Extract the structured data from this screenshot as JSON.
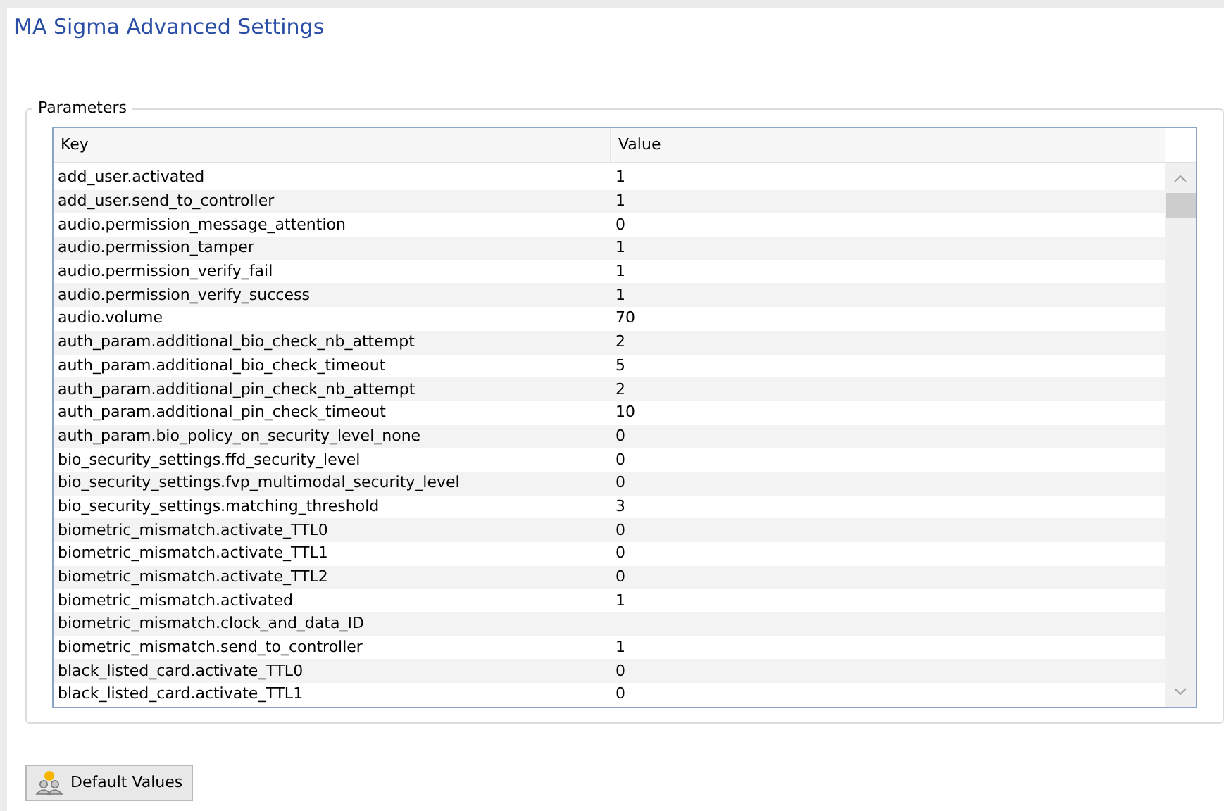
{
  "title": "MA Sigma Advanced Settings",
  "group": {
    "legend": "Parameters"
  },
  "table": {
    "columns": [
      "Key",
      "Value"
    ],
    "rows": [
      {
        "key": "add_user.activated",
        "value": "1"
      },
      {
        "key": "add_user.send_to_controller",
        "value": "1"
      },
      {
        "key": "audio.permission_message_attention",
        "value": "0"
      },
      {
        "key": "audio.permission_tamper",
        "value": "1"
      },
      {
        "key": "audio.permission_verify_fail",
        "value": "1"
      },
      {
        "key": "audio.permission_verify_success",
        "value": "1"
      },
      {
        "key": "audio.volume",
        "value": "70"
      },
      {
        "key": "auth_param.additional_bio_check_nb_attempt",
        "value": "2"
      },
      {
        "key": "auth_param.additional_bio_check_timeout",
        "value": "5"
      },
      {
        "key": "auth_param.additional_pin_check_nb_attempt",
        "value": "2"
      },
      {
        "key": "auth_param.additional_pin_check_timeout",
        "value": "10"
      },
      {
        "key": "auth_param.bio_policy_on_security_level_none",
        "value": "0"
      },
      {
        "key": "bio_security_settings.ffd_security_level",
        "value": "0"
      },
      {
        "key": "bio_security_settings.fvp_multimodal_security_level",
        "value": "0"
      },
      {
        "key": "bio_security_settings.matching_threshold",
        "value": "3"
      },
      {
        "key": "biometric_mismatch.activate_TTL0",
        "value": "0"
      },
      {
        "key": "biometric_mismatch.activate_TTL1",
        "value": "0"
      },
      {
        "key": "biometric_mismatch.activate_TTL2",
        "value": "0"
      },
      {
        "key": "biometric_mismatch.activated",
        "value": "1"
      },
      {
        "key": "biometric_mismatch.clock_and_data_ID"
      },
      {
        "key": "biometric_mismatch.send_to_controller",
        "value": "1"
      },
      {
        "key": "black_listed_card.activate_TTL0",
        "value": "0"
      },
      {
        "key": "black_listed_card.activate_TTL1",
        "value": "0"
      }
    ]
  },
  "buttons": [
    {
      "label": "Default Values"
    }
  ]
}
